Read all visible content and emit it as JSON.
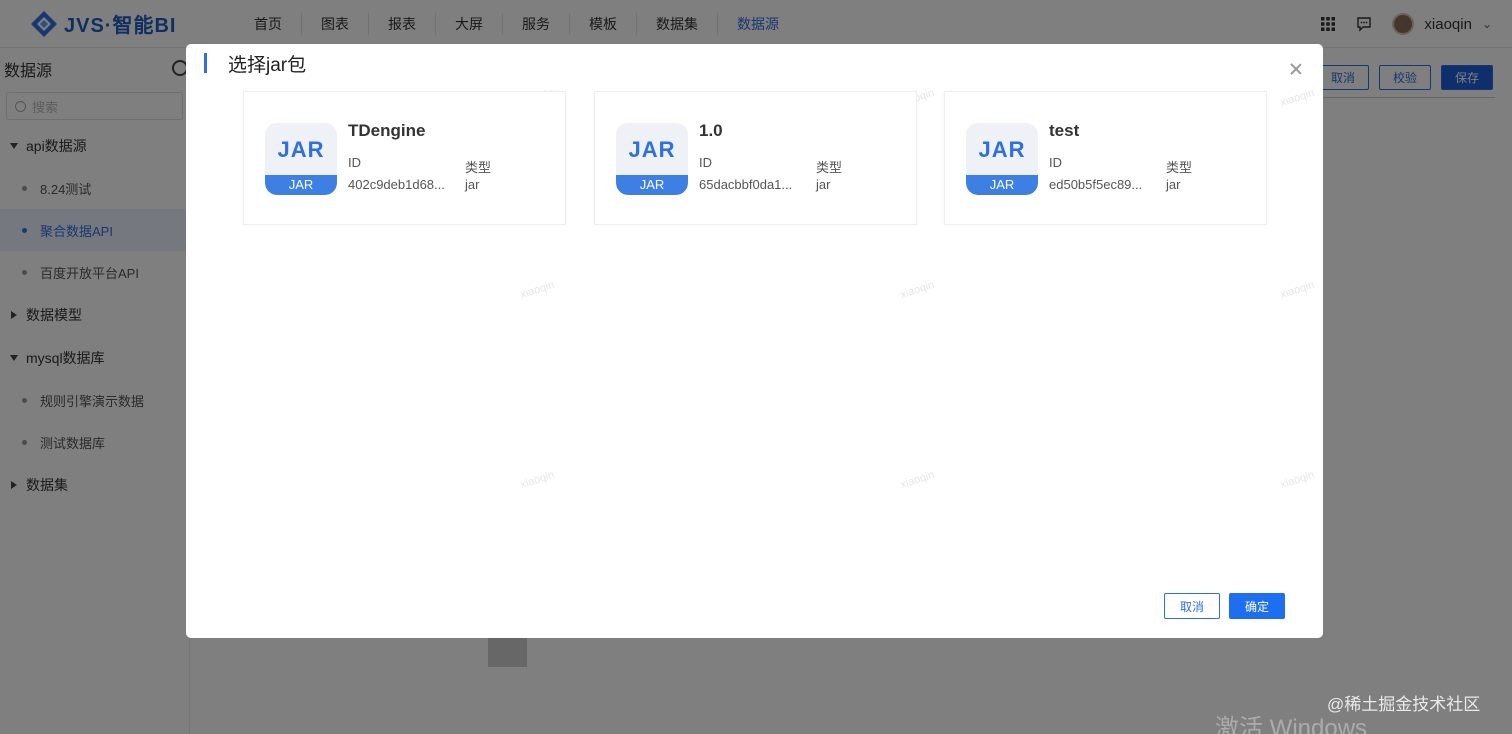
{
  "app": {
    "brand": "JVS·智能BI"
  },
  "nav": {
    "items": [
      {
        "label": "首页"
      },
      {
        "label": "图表"
      },
      {
        "label": "报表"
      },
      {
        "label": "大屏"
      },
      {
        "label": "服务"
      },
      {
        "label": "模板"
      },
      {
        "label": "数据集"
      },
      {
        "label": "数据源",
        "active": true
      }
    ]
  },
  "user": {
    "name": "xiaoqin"
  },
  "sidebar": {
    "title": "数据源",
    "search_placeholder": "搜索",
    "groups": [
      {
        "label": "api数据源",
        "expanded": true,
        "items": [
          "8.24测试",
          "聚合数据API",
          "百度开放平台API"
        ]
      },
      {
        "label": "数据模型",
        "expanded": false
      },
      {
        "label": "mysql数据库",
        "expanded": true,
        "items": [
          "规则引擎演示数据",
          "测试数据库"
        ]
      },
      {
        "label": "数据集",
        "expanded": false
      }
    ],
    "active_item": "聚合数据API"
  },
  "toolbar": {
    "cancel_label": "取消",
    "verify_label": "校验",
    "save_label": "保存"
  },
  "modal": {
    "title": "选择jar包",
    "cards": [
      {
        "name": "TDengine",
        "id_label": "ID",
        "id_value": "402c9deb1d68...",
        "type_label": "类型",
        "type_value": "jar",
        "icon_text": "JAR",
        "icon_band": "JAR"
      },
      {
        "name": "1.0",
        "id_label": "ID",
        "id_value": "65dacbbf0da1...",
        "type_label": "类型",
        "type_value": "jar",
        "icon_text": "JAR",
        "icon_band": "JAR"
      },
      {
        "name": "test",
        "id_label": "ID",
        "id_value": "ed50b5f5ec89...",
        "type_label": "类型",
        "type_value": "jar",
        "icon_text": "JAR",
        "icon_band": "JAR"
      }
    ],
    "watermark": "xiaoqin",
    "cancel_label": "取消",
    "ok_label": "确定"
  },
  "credits": {
    "site": "@稀土掘金技术社区",
    "windows": "激活 Windows"
  },
  "colors": {
    "accent": "#2f6fe0",
    "brand": "#1d5fbf",
    "primary_button": "#1d6ff0"
  }
}
